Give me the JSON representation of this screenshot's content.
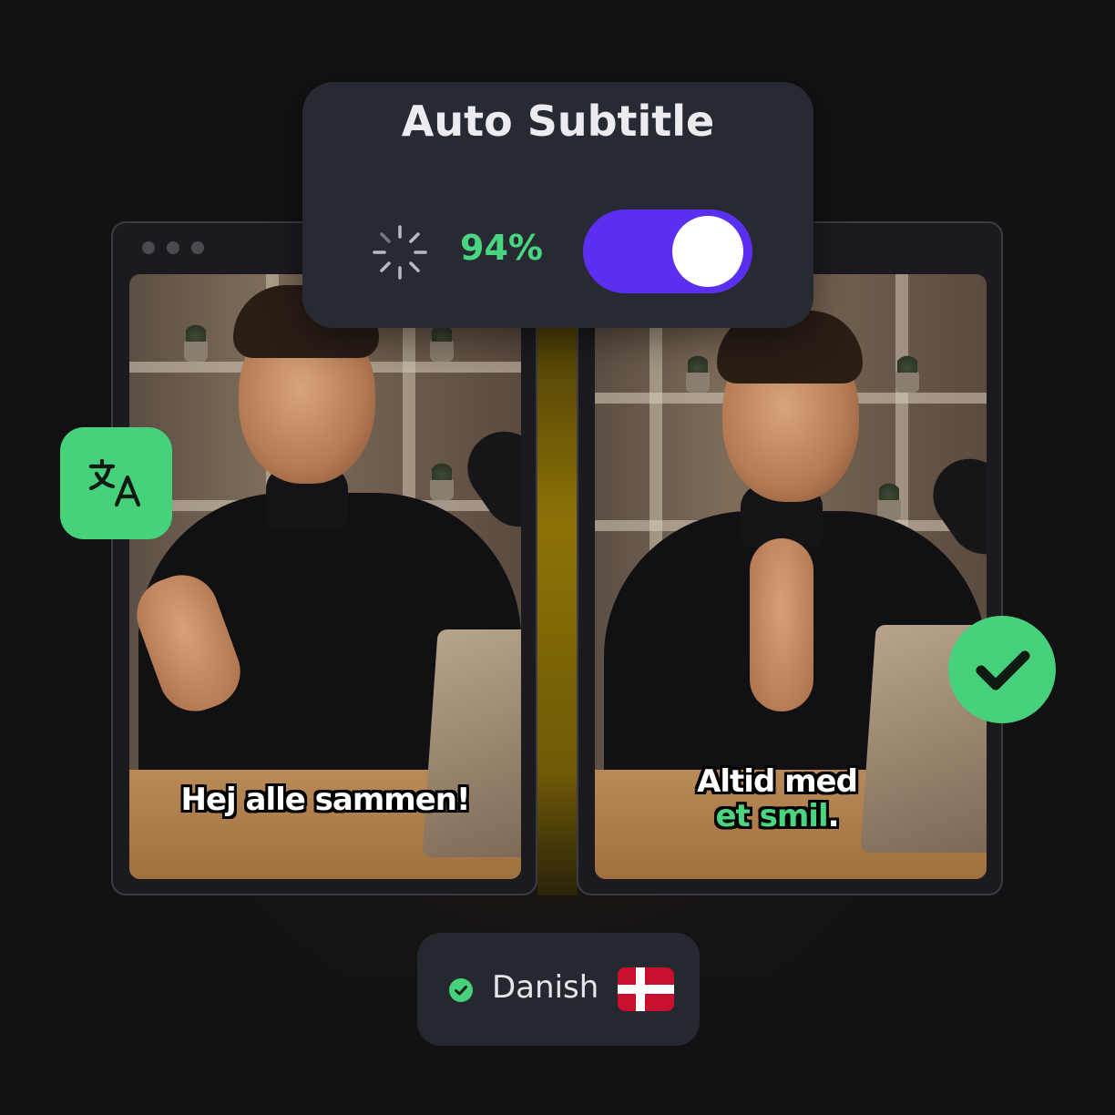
{
  "card": {
    "title": "Auto Subtitle",
    "progress_percent": 94,
    "progress_text": "94%",
    "toggle_on": true
  },
  "videos": [
    {
      "caption_line1": "Hej alle sammen!"
    },
    {
      "caption_line1": "Altid med",
      "caption_line2_a": "et smil",
      "caption_line2_b": "."
    }
  ],
  "language": {
    "name": "Danish",
    "flag": "denmark-flag"
  },
  "icons": {
    "translate": "translate-icon",
    "check": "check-icon",
    "spinner": "loading-spinner-icon"
  },
  "colors": {
    "background": "#121114",
    "card": "#282a33",
    "accent_green": "#46d17a",
    "toggle_purple": "#5b2ff0",
    "caption_highlight": "#4ad680"
  }
}
